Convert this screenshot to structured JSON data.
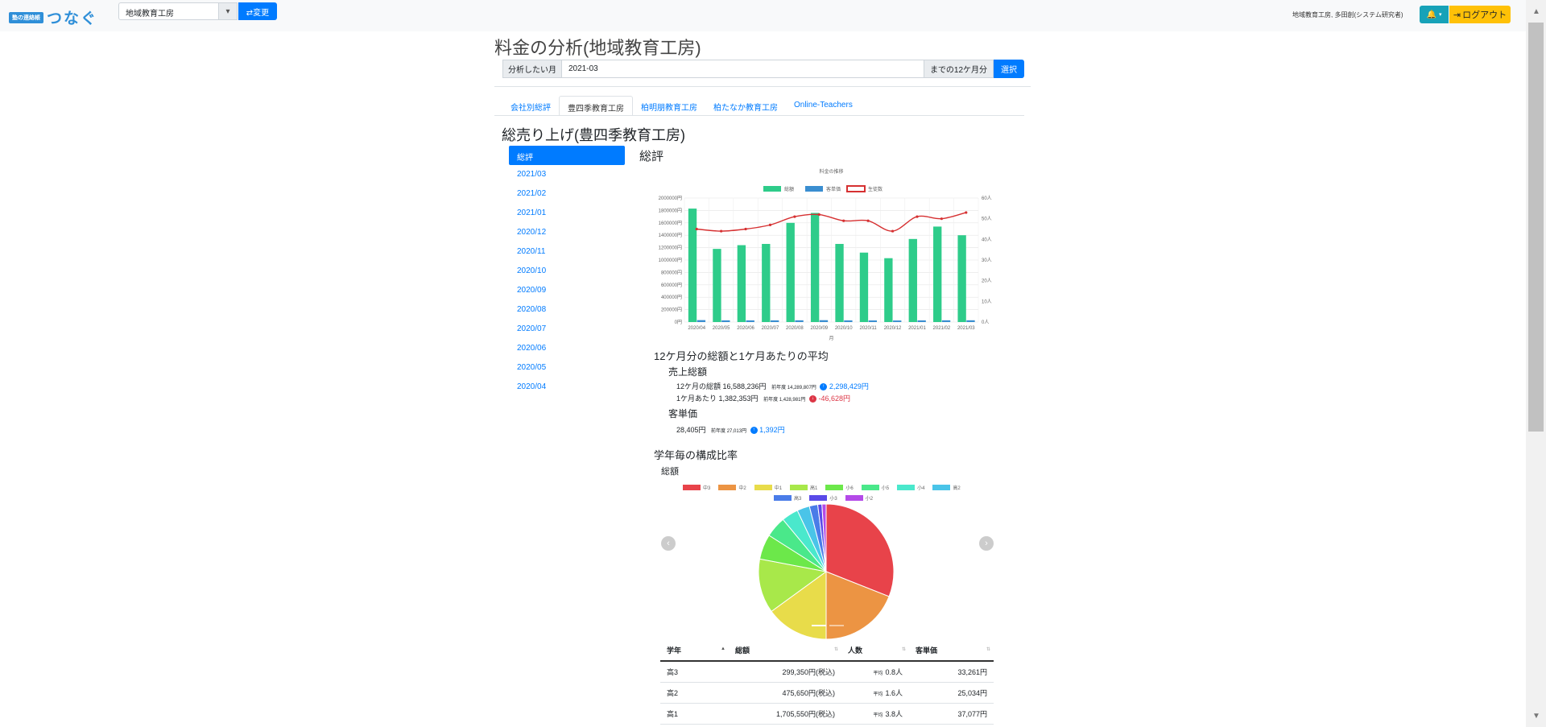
{
  "navbar": {
    "logo_badge": "塾の連絡帳",
    "logo_text": "つなぐ",
    "company_value": "地域教育工房",
    "change_label": "⇄変更",
    "user_info": "地域教育工房, 多田創(システム研究者)",
    "logout_label": "ログアウト"
  },
  "page": {
    "title": "料金の分析(地域教育工房)",
    "month_label": "分析したい月",
    "month_value": "2021-03",
    "month_suffix": "までの12ケ月分",
    "select_label": "選択"
  },
  "tabs": [
    {
      "label": "会社別総評"
    },
    {
      "label": "豊四季教育工房",
      "active": true
    },
    {
      "label": "柏明朋教育工房"
    },
    {
      "label": "柏たなか教育工房"
    },
    {
      "label": "Online-Teachers"
    }
  ],
  "section_title": "総売り上げ(豊四季教育工房)",
  "side_nav": [
    "総評",
    "2021/03",
    "2021/02",
    "2021/01",
    "2020/12",
    "2020/11",
    "2020/10",
    "2020/09",
    "2020/08",
    "2020/07",
    "2020/06",
    "2020/05",
    "2020/04"
  ],
  "sub_title": "総評",
  "chart_data": {
    "type": "bar",
    "title": "料金の推移",
    "xlabel": "月",
    "categories": [
      "2020/04",
      "2020/05",
      "2020/06",
      "2020/07",
      "2020/08",
      "2020/09",
      "2020/10",
      "2020/11",
      "2020/12",
      "2021/01",
      "2021/02",
      "2021/03"
    ],
    "series": [
      {
        "name": "総額",
        "type": "bar",
        "axis": "left",
        "color": "#2ecc8a",
        "values": [
          1830000,
          1180000,
          1240000,
          1260000,
          1600000,
          1760000,
          1260000,
          1120000,
          1030000,
          1340000,
          1540000,
          1400000
        ]
      },
      {
        "name": "客単価",
        "type": "bar",
        "axis": "left",
        "color": "#3a8ed0",
        "values": [
          31000,
          27000,
          27000,
          27000,
          28000,
          30000,
          27000,
          26000,
          25000,
          27000,
          28000,
          28405
        ]
      },
      {
        "name": "生徒数",
        "type": "line",
        "axis": "right",
        "color": "#d63031",
        "values": [
          45,
          44,
          45,
          47,
          51,
          52,
          49,
          49,
          44,
          51,
          50,
          53
        ]
      }
    ],
    "ylim_left": [
      0,
      2000000
    ],
    "left_ticks": [
      "0円",
      "200000円",
      "400000円",
      "600000円",
      "800000円",
      "1000000円",
      "1200000円",
      "1400000円",
      "1600000円",
      "1800000円",
      "2000000円"
    ],
    "ylim_right": [
      0,
      60
    ],
    "right_ticks": [
      "0人",
      "10人",
      "20人",
      "30人",
      "40人",
      "50人",
      "60人"
    ],
    "grid": true,
    "legend": "top-center"
  },
  "summary": {
    "title": "12ケ月分の総額と1ケ月あたりの平均",
    "sales_heading": "売上総額",
    "total_label": "12ケ月の総額 16,588,236円",
    "total_prev": "前年度 14,289,807円",
    "total_diff": "2,298,429円",
    "monthly_label": "1ケ月あたり 1,382,353円",
    "monthly_prev": "前年度 1,428,981円",
    "monthly_diff": "-46,628円",
    "unit_heading": "客単価",
    "unit_label": "28,405円",
    "unit_prev": "前年度 27,013円",
    "unit_diff": "1,392円"
  },
  "ratio": {
    "title": "学年毎の構成比率",
    "subtitle": "総額",
    "legend": [
      {
        "name": "中3",
        "color": "#e8434a"
      },
      {
        "name": "中2",
        "color": "#ec9443"
      },
      {
        "name": "中1",
        "color": "#e8dc4a"
      },
      {
        "name": "高1",
        "color": "#a8e84a"
      },
      {
        "name": "小6",
        "color": "#6ce84a"
      },
      {
        "name": "小5",
        "color": "#4ae88a"
      },
      {
        "name": "小4",
        "color": "#4ae8cc"
      },
      {
        "name": "高2",
        "color": "#4ac4e8"
      },
      {
        "name": "高3",
        "color": "#4a7ce8"
      },
      {
        "name": "小3",
        "color": "#5a4ae8"
      },
      {
        "name": "小2",
        "color": "#b44ae8"
      }
    ],
    "pie_values": [
      31,
      19,
      15,
      13,
      6,
      5,
      4,
      3,
      2,
      1,
      1
    ]
  },
  "table": {
    "headers": [
      "学年",
      "総額",
      "人数",
      "客単価"
    ],
    "rows": [
      {
        "grade": "高3",
        "total": "299,350円(税込)",
        "avg_tag": "平均",
        "count": "0.8人",
        "unit": "33,261円"
      },
      {
        "grade": "高2",
        "total": "475,650円(税込)",
        "avg_tag": "平均",
        "count": "1.6人",
        "unit": "25,034円"
      },
      {
        "grade": "高1",
        "total": "1,705,550円(税込)",
        "avg_tag": "平均",
        "count": "3.8人",
        "unit": "37,077円"
      }
    ]
  }
}
